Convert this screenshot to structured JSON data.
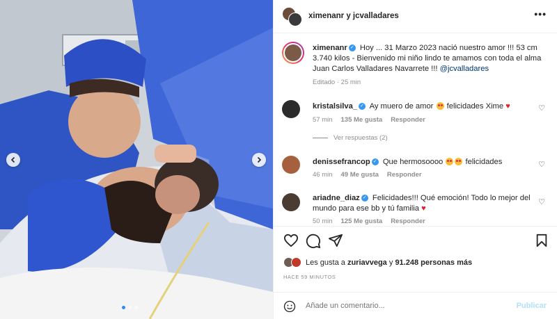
{
  "header": {
    "title": "ximenanr y jcvalladares",
    "more_icon": "more-horizontal-icon"
  },
  "caption": {
    "username": "ximenanr",
    "text_a": "Hoy ... 31 Marzo 2023 nació nuestro amor !!! 53 cm 3.740 kilos - Bienvenido mi niño lindo te amamos con toda el alma Juan Carlos Valladares Navarrete !!! ",
    "mention": "@jcvalladares",
    "meta": "Editado · 25 min"
  },
  "comments": [
    {
      "username": "kristalsilva_",
      "text_a": "Ay muero de amor ",
      "text_b": " felicidades Xime ",
      "time": "57 min",
      "likes": "135 Me gusta",
      "reply": "Responder",
      "view_replies": "Ver respuestas (2)"
    },
    {
      "username": "denissefrancop",
      "text_a": "Que hermosoooo ",
      "text_b": " felicidades",
      "time": "46 min",
      "likes": "49 Me gusta",
      "reply": "Responder"
    },
    {
      "username": "ariadne_diaz",
      "text_a": "Felicidades!!! Qué emoción! Todo lo mejor del mundo para ese bb y tú familia ",
      "time": "50 min",
      "likes": "125 Me gusta",
      "reply": "Responder"
    }
  ],
  "likes": {
    "prefix": "Les gusta a ",
    "user": "zuriavvega",
    "mid": " y ",
    "count": "91.248 personas más"
  },
  "time_ago": "HACE 59 MINUTOS",
  "add_comment": {
    "placeholder": "Añade un comentario...",
    "publish": "Publicar"
  },
  "colors": {
    "accent_blue": "#3897f0",
    "heart_red": "#ed1c24",
    "scrub_blue": "#3a64d8"
  }
}
